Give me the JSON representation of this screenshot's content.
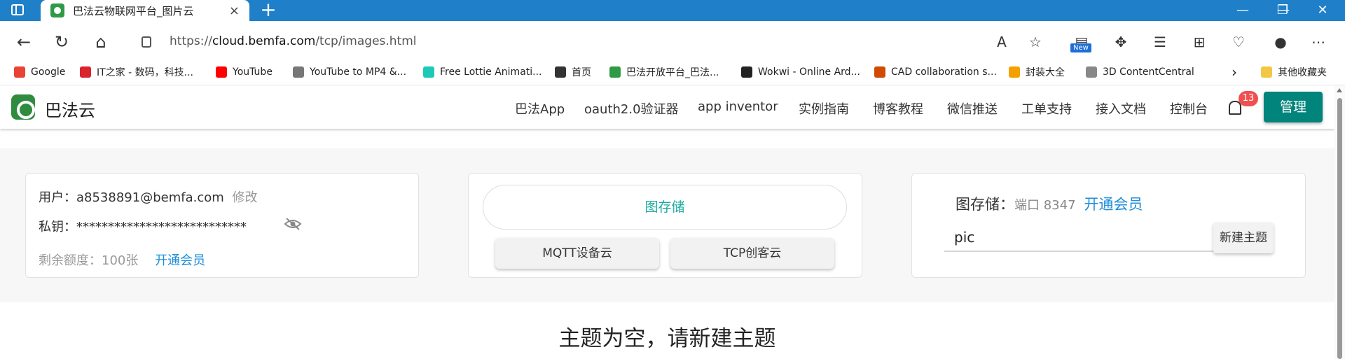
{
  "browser": {
    "tab_title": "巴法云物联网平台_图片云",
    "tab_close": "×",
    "new_tab": "+",
    "url_scheme": "https://",
    "url_host": "cloud.bemfa.com",
    "url_path": "/tcp/images.html",
    "new_badge": "New",
    "win_min": "—",
    "win_max": "❐",
    "win_close": "✕",
    "nav_back": "←",
    "nav_refresh": "↻",
    "nav_home": "⌂"
  },
  "bookmarks": [
    {
      "label": "Google",
      "color": "#ea4335"
    },
    {
      "label": "IT之家 - 数码，科技...",
      "color": "#d9232d"
    },
    {
      "label": "YouTube",
      "color": "#ff0000"
    },
    {
      "label": "YouTube to MP4 &...",
      "color": "#555555"
    },
    {
      "label": "Free Lottie Animati...",
      "color": "#1dc9b7"
    },
    {
      "label": "首页",
      "color": "#333333"
    },
    {
      "label": "巴法开放平台_巴法...",
      "color": "#2f9a45"
    },
    {
      "label": "Wokwi - Online Ard...",
      "color": "#222222"
    },
    {
      "label": "CAD collaboration s...",
      "color": "#d04a02"
    },
    {
      "label": "封装大全",
      "color": "#f4a000"
    },
    {
      "label": "3D ContentCentral",
      "color": "#888888"
    }
  ],
  "bookmarks_more": "›",
  "bookmarks_other": "其他收藏夹",
  "site": {
    "logo_text": "巴法云",
    "nav": [
      "巴法App",
      "oauth2.0验证器",
      "app inventor",
      "实例指南",
      "博客教程",
      "微信推送",
      "工单支持",
      "接入文档",
      "控制台"
    ],
    "notification_count": "13",
    "manage_label": "管理"
  },
  "account_card": {
    "user_label": "用户：",
    "user_email": "a8538891@bemfa.com",
    "edit_label": "修改",
    "key_label": "私钥：",
    "key_masked": "***************************",
    "quota_label": "剩余额度：100张",
    "vip_link": "开通会员"
  },
  "service_card": {
    "image_storage_button": "图存储",
    "mqtt_button": "MQTT设备云",
    "tcp_button": "TCP创客云"
  },
  "topic_card": {
    "title": "图存储：",
    "port": "端口 8347",
    "vip_link": "开通会员",
    "input_value": "pic",
    "new_topic_button": "新建主题"
  },
  "empty_message": "主题为空，请新建主题"
}
